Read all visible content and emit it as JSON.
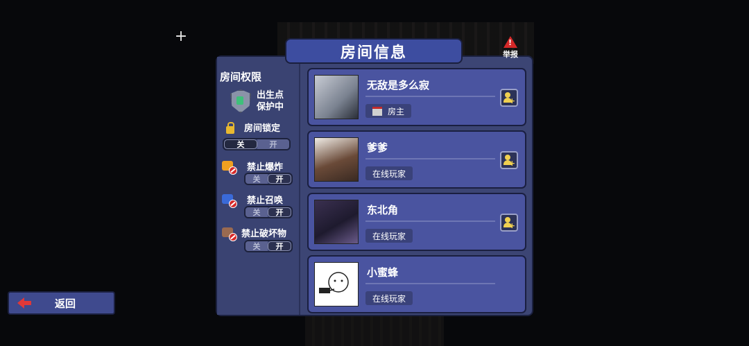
{
  "dialog": {
    "title": "房间信息",
    "report_label": "举报"
  },
  "permissions": {
    "title": "房间权限",
    "spawn_protection": {
      "line1": "出生点",
      "line2": "保护中"
    },
    "room_lock": {
      "label": "房间锁定",
      "off": "关",
      "on": "开",
      "state": "off"
    },
    "no_explosion": {
      "label": "禁止爆炸",
      "off": "关",
      "on": "开",
      "state": "on"
    },
    "no_summon": {
      "label": "禁止召唤",
      "off": "关",
      "on": "开",
      "state": "on"
    },
    "no_destroy": {
      "label": "禁止破坏物",
      "off": "关",
      "on": "开",
      "state": "on"
    }
  },
  "players": [
    {
      "name": "无敌是多么寂",
      "role": "房主",
      "role_icon": "house-icon",
      "has_add": true
    },
    {
      "name": "爹爹",
      "role": "在线玩家",
      "has_add": true
    },
    {
      "name": "东北角",
      "role": "在线玩家",
      "has_add": true
    },
    {
      "name": "小蜜蜂",
      "role": "在线玩家",
      "has_add": false
    }
  ],
  "footer": {
    "back_label": "返回"
  },
  "colors": {
    "panel": "#3c4574",
    "card": "#4a54a0",
    "title_tab": "#3d4da0",
    "accent_red": "#d42828"
  }
}
